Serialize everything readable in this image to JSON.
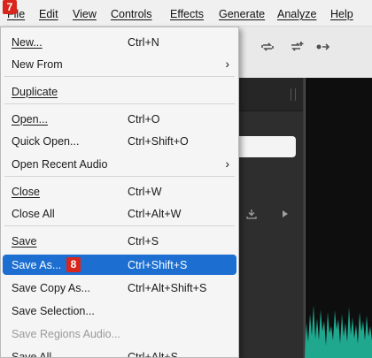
{
  "menubar": {
    "items": [
      {
        "label": "File"
      },
      {
        "label": "Edit"
      },
      {
        "label": "View"
      },
      {
        "label": "Controls"
      },
      {
        "label": "Effects"
      },
      {
        "label": "Generate"
      },
      {
        "label": "Analyze"
      },
      {
        "label": "Help"
      }
    ],
    "step_badge": "7"
  },
  "file_menu": {
    "items": [
      {
        "label": "New...",
        "shortcut": "Ctrl+N"
      },
      {
        "label": "New From",
        "shortcut": "",
        "submenu": true
      },
      {
        "label": "Duplicate",
        "shortcut": ""
      },
      {
        "label": "Open...",
        "shortcut": "Ctrl+O"
      },
      {
        "label": "Quick Open...",
        "shortcut": "Ctrl+Shift+O"
      },
      {
        "label": "Open Recent Audio",
        "shortcut": "",
        "submenu": true
      },
      {
        "label": "Close",
        "shortcut": "Ctrl+W"
      },
      {
        "label": "Close All",
        "shortcut": "Ctrl+Alt+W"
      },
      {
        "label": "Save",
        "shortcut": "Ctrl+S"
      },
      {
        "label": "Save As...",
        "shortcut": "Ctrl+Shift+S",
        "selected": true
      },
      {
        "label": "Save Copy As...",
        "shortcut": "Ctrl+Alt+Shift+S"
      },
      {
        "label": "Save Selection...",
        "shortcut": ""
      },
      {
        "label": "Save Regions Audio...",
        "shortcut": "",
        "disabled": true
      },
      {
        "label": "Save All",
        "shortcut": "Ctrl+Alt+S"
      }
    ],
    "step_badge": "8",
    "submenu_arrow": "›"
  },
  "toolbar": {
    "icons": [
      "loop-icon",
      "loop-add-icon",
      "skip-icon"
    ]
  },
  "colors": {
    "selection": "#1c6ed1",
    "badge": "#d9261c",
    "waveform": "#1fa88e"
  }
}
